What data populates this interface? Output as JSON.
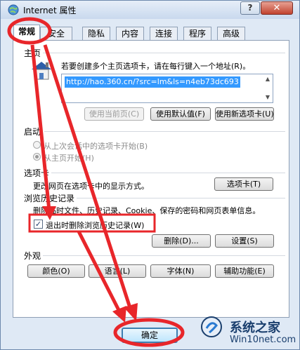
{
  "window": {
    "title": "Internet 属性",
    "help_label": "?",
    "close_label": "✕"
  },
  "tabs": [
    "常规",
    "安全",
    "隐私",
    "内容",
    "连接",
    "程序",
    "高级"
  ],
  "home": {
    "label": "主页",
    "hint": "若要创建多个主页选项卡，请在每行键入一个地址(R)。",
    "url": "http://hao.360.cn/?src=lm&ls=n4eb73dc693",
    "btn_current": "使用当前页(C)",
    "btn_default": "使用默认值(F)",
    "btn_newtab": "使用新选项卡(U)"
  },
  "startup": {
    "label": "启动",
    "opt_last": "从上次会话中的选项卡开始(B)",
    "opt_home": "从主页开始(H)"
  },
  "tabs_section": {
    "label": "选项卡",
    "desc": "更改网页在选项卡中的显示方式。",
    "btn": "选项卡(T)"
  },
  "history": {
    "label": "浏览历史记录",
    "desc": "删除临时文件、历史记录、Cookie、保存的密码和网页表单信息。",
    "checkbox_label": "退出时删除浏览历史记录(W)",
    "checkbox_checked": true,
    "btn_delete": "删除(D)...",
    "btn_settings": "设置(S)"
  },
  "appearance": {
    "label": "外观",
    "btn_colors": "颜色(O)",
    "btn_languages": "语言(L)",
    "btn_fonts": "字体(N)",
    "btn_accessibility": "辅助功能(E)"
  },
  "footer": {
    "ok": "确定"
  },
  "watermark": {
    "title": "系统之家",
    "url": "Win10net.com"
  },
  "colors": {
    "annotation_red": "#e8262a",
    "selection": "#3399ff"
  }
}
